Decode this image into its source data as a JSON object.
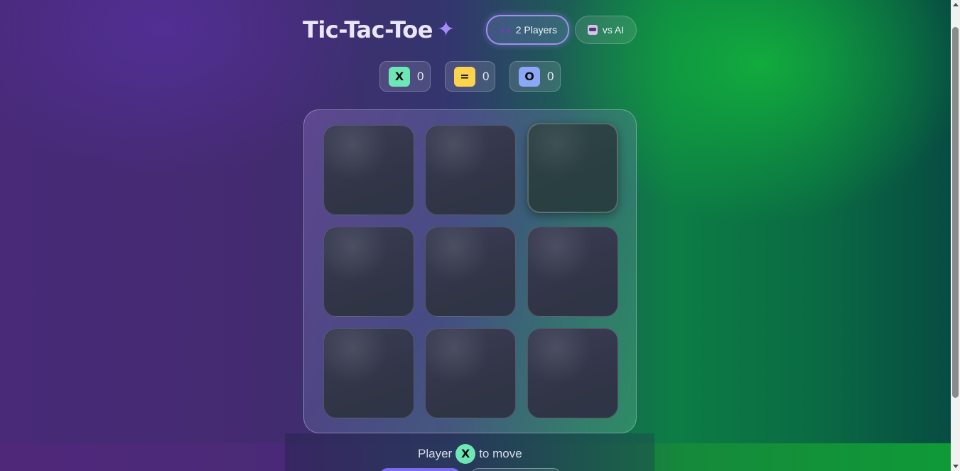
{
  "header": {
    "title": "Tic-Tac-Toe",
    "sparkle_icon": "sparkle-icon"
  },
  "modes": [
    {
      "label": "2 Players",
      "icon": "two-people-icon",
      "selected": true
    },
    {
      "label": "vs AI",
      "icon": "robot-icon",
      "selected": false
    }
  ],
  "scores": {
    "x": {
      "symbol": "X",
      "value": "0",
      "color": "#6ee7b7"
    },
    "draw": {
      "symbol": "=",
      "value": "0",
      "color": "#fcd34d"
    },
    "o": {
      "symbol": "O",
      "value": "0",
      "color": "#8aa8f5"
    }
  },
  "board": {
    "cells": [
      "",
      "",
      "",
      "",
      "",
      "",
      "",
      "",
      ""
    ],
    "hovered_cell": 2
  },
  "status": {
    "prefix": "Player",
    "player": "X",
    "suffix": "to move"
  },
  "colors": {
    "accent": "#a78bfa",
    "player_x": "#6ee7b7",
    "player_o": "#8aa8f5",
    "draw": "#fcd34d"
  }
}
